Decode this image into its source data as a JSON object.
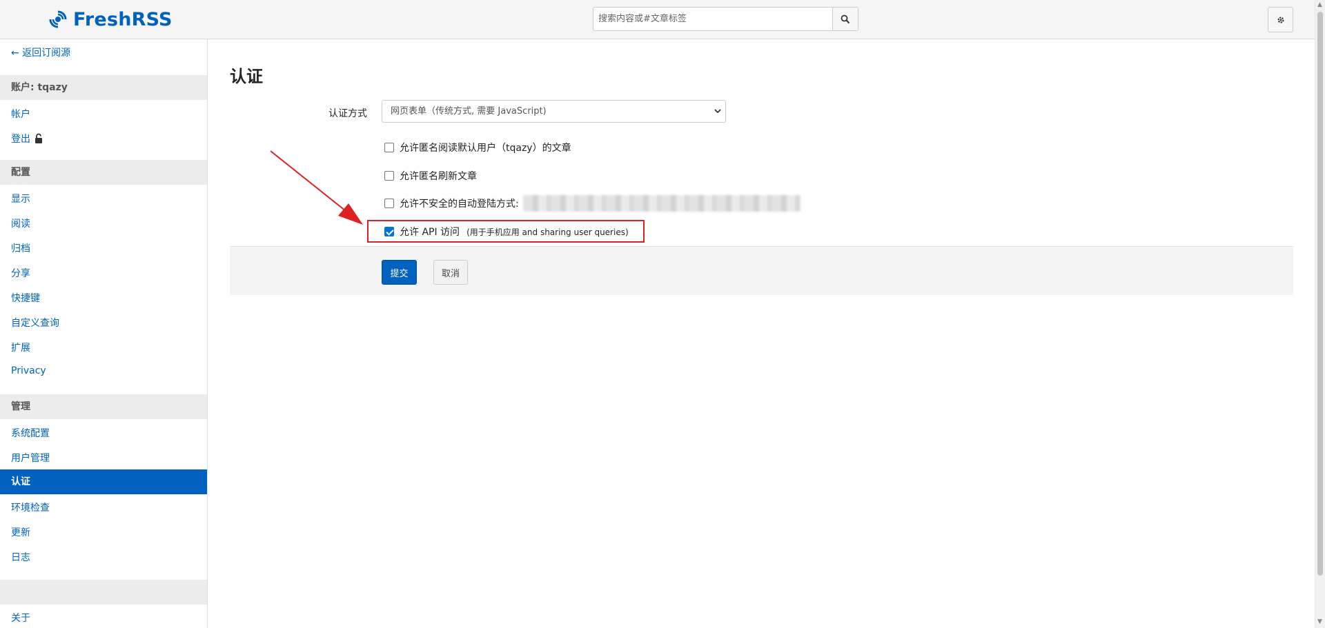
{
  "header": {
    "logo_text": "FreshRSS",
    "search_placeholder": "搜索内容或#文章标签"
  },
  "sidebar": {
    "back_link": "← 返回订阅源",
    "account_header": "账户: tqazy",
    "account_items": [
      "帐户",
      "登出"
    ],
    "config_header": "配置",
    "config_items": [
      "显示",
      "阅读",
      "归档",
      "分享",
      "快捷键",
      "自定义查询",
      "扩展",
      "Privacy"
    ],
    "admin_header": "管理",
    "admin_items": [
      "系统配置",
      "用户管理",
      "认证",
      "环境检查",
      "更新",
      "日志"
    ],
    "active_item": "认证",
    "about": "关于"
  },
  "main": {
    "title": "认证",
    "auth_method_label": "认证方式",
    "auth_method_value": "网页表单（传统方式, 需要 JavaScript)",
    "checkboxes": [
      {
        "label": "允许匿名阅读默认用户（tqazy）的文章",
        "checked": false
      },
      {
        "label": "允许匿名刷新文章",
        "checked": false
      },
      {
        "label": "允许不安全的自动登陆方式:",
        "checked": false
      },
      {
        "label": "允许 API 访问",
        "note": "(用于手机应用 and sharing user queries)",
        "checked": true
      }
    ],
    "submit_label": "提交",
    "cancel_label": "取消"
  },
  "colors": {
    "brand": "#0062be",
    "highlight": "#e02020"
  }
}
